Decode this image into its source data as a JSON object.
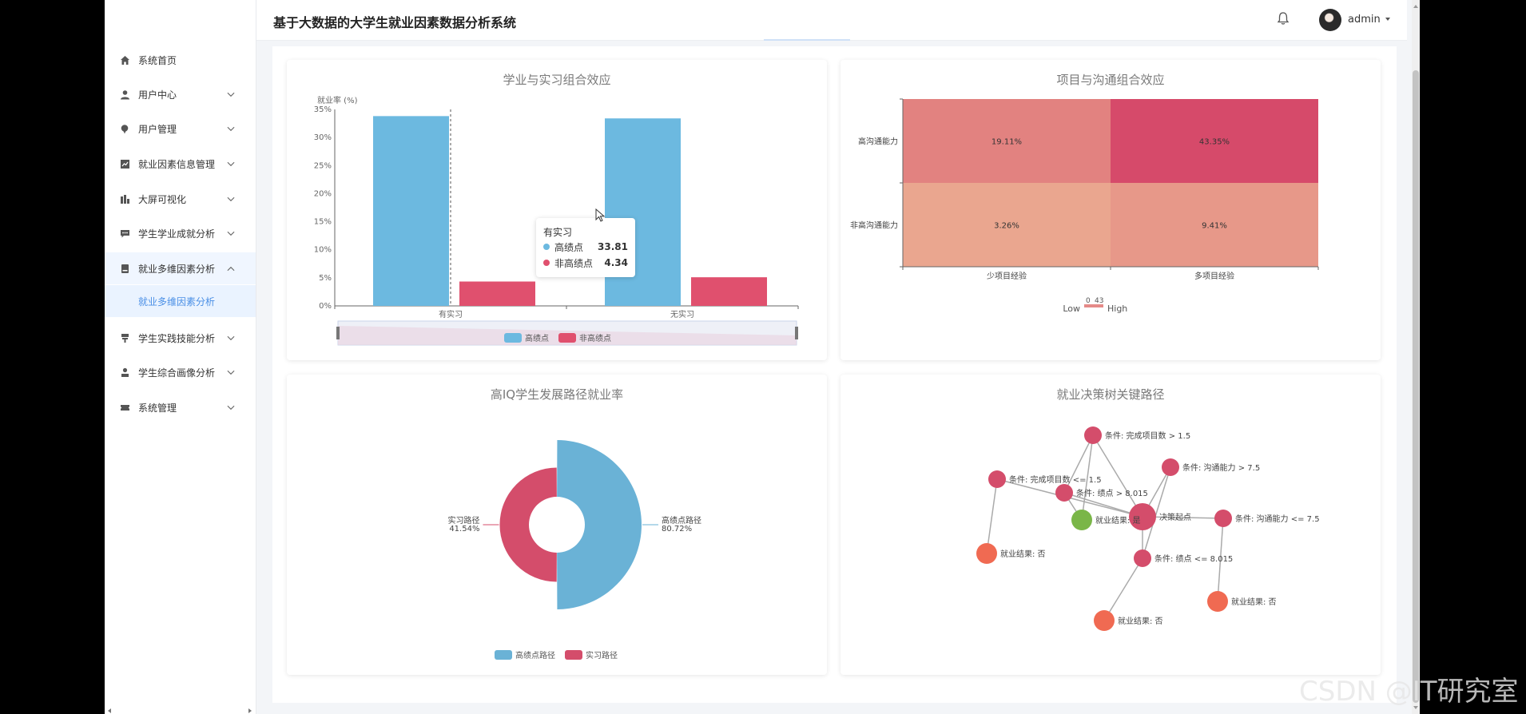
{
  "app": {
    "title": "基于大数据的大学生就业因素数据分析系统",
    "user": "admin",
    "watermark": "CSDN @IT研究室"
  },
  "sidebar": {
    "items": [
      {
        "label": "系统首页",
        "icon": "home-icon"
      },
      {
        "label": "用户中心",
        "icon": "user-icon"
      },
      {
        "label": "用户管理",
        "icon": "pin-icon"
      },
      {
        "label": "就业因素信息管理",
        "icon": "chart-icon"
      },
      {
        "label": "大屏可视化",
        "icon": "bar-icon"
      },
      {
        "label": "学生学业成就分析",
        "icon": "message-icon"
      },
      {
        "label": "就业多维因素分析",
        "icon": "document-icon"
      },
      {
        "label": "学生实践技能分析",
        "icon": "trophy-icon"
      },
      {
        "label": "学生综合画像分析",
        "icon": "person-icon"
      },
      {
        "label": "系统管理",
        "icon": "ticket-icon"
      }
    ],
    "sub_item": "就业多维因素分析"
  },
  "charts": {
    "bar": {
      "title": "学业与实习组合效应"
    },
    "heatmap": {
      "title": "项目与沟通组合效应"
    },
    "pie": {
      "title": "高IQ学生发展路径就业率"
    },
    "tree": {
      "title": "就业决策树关键路径"
    }
  },
  "tooltip": {
    "title": "有实习",
    "rows": [
      {
        "name": "高绩点",
        "value": "33.81"
      },
      {
        "name": "非高绩点",
        "value": "4.34"
      }
    ]
  },
  "chart_data": [
    {
      "type": "bar",
      "title": "学业与实习组合效应",
      "ylabel": "就业率 (%)",
      "categories": [
        "有实习",
        "无实习"
      ],
      "series": [
        {
          "name": "高绩点",
          "values": [
            33.81,
            33.4
          ],
          "color": "#6cb9e0"
        },
        {
          "name": "非高绩点",
          "values": [
            4.34,
            5.1
          ],
          "color": "#e0506e"
        }
      ],
      "ylim": [
        0,
        35
      ],
      "yticks": [
        "0%",
        "5%",
        "10%",
        "15%",
        "20%",
        "25%",
        "30%",
        "35%"
      ],
      "legend": "bottom"
    },
    {
      "type": "heatmap",
      "title": "项目与沟通组合效应",
      "x": [
        "少项目经验",
        "多项目经验"
      ],
      "y": [
        "高沟通能力",
        "非高沟通能力"
      ],
      "values": [
        [
          19.11,
          43.35
        ],
        [
          3.26,
          9.41
        ]
      ],
      "labels": [
        [
          "19.11%",
          "43.35%"
        ],
        [
          "3.26%",
          "9.41%"
        ]
      ],
      "visual_map": {
        "min": 0,
        "max": 43,
        "low_label": "Low",
        "high_label": "High"
      }
    },
    {
      "type": "pie",
      "title": "高IQ学生发展路径就业率",
      "series": [
        {
          "name": "高绩点路径",
          "value": 80.72,
          "label": "80.72%",
          "color": "#6ab2d6"
        },
        {
          "name": "实习路径",
          "value": 41.54,
          "label": "41.54%",
          "color": "#d44d6b"
        }
      ],
      "legend": "bottom"
    },
    {
      "type": "graph",
      "title": "就业决策树关键路径",
      "nodes": [
        {
          "id": "root",
          "label": "决策起点"
        },
        {
          "id": "c1",
          "label": "条件: 完成项目数 > 1.5"
        },
        {
          "id": "c2",
          "label": "条件: 完成项目数 <= 1.5"
        },
        {
          "id": "c3",
          "label": "条件: 绩点 > 8.015"
        },
        {
          "id": "c4",
          "label": "条件: 沟通能力 > 7.5"
        },
        {
          "id": "c5",
          "label": "条件: 沟通能力 <= 7.5"
        },
        {
          "id": "c6",
          "label": "条件: 绩点 <= 8.015"
        },
        {
          "id": "r1",
          "label": "就业结果: 是"
        },
        {
          "id": "r2",
          "label": "就业结果: 否"
        },
        {
          "id": "r3",
          "label": "就业结果: 否"
        },
        {
          "id": "r4",
          "label": "就业结果: 否"
        }
      ],
      "links": [
        [
          "root",
          "c1"
        ],
        [
          "root",
          "c2"
        ],
        [
          "root",
          "c3"
        ],
        [
          "root",
          "c4"
        ],
        [
          "root",
          "c5"
        ],
        [
          "root",
          "c6"
        ],
        [
          "c1",
          "c3"
        ],
        [
          "c3",
          "r1"
        ],
        [
          "c1",
          "r1"
        ],
        [
          "c2",
          "r2"
        ],
        [
          "c6",
          "r4"
        ],
        [
          "c5",
          "r3"
        ],
        [
          "c4",
          "c6"
        ]
      ],
      "colors": {
        "root": "#d44d6b",
        "condition": "#d44d6b",
        "yes": "#7ab648",
        "no": "#f06a52",
        "link": "#aaaaaa"
      }
    }
  ]
}
